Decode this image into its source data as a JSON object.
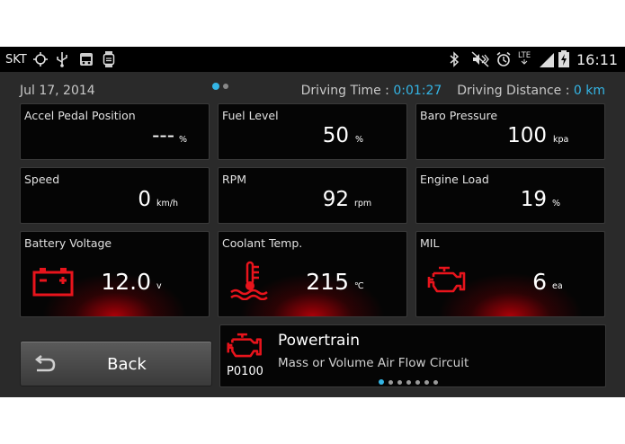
{
  "status_bar": {
    "carrier": "SKT",
    "network_type": "LTE",
    "time": "16:11",
    "left_icons": [
      "gps-icon",
      "usb-icon",
      "car-icon",
      "watch-icon"
    ],
    "right_icons": [
      "bluetooth-icon",
      "mute-icon",
      "alarm-icon",
      "signal-icon",
      "battery-charging-icon"
    ]
  },
  "header": {
    "date": "Jul 17, 2014",
    "driving_time_label": "Driving Time : ",
    "driving_time_value": "0:01:27",
    "driving_distance_label": "Driving Distance : ",
    "driving_distance_value": "0 km",
    "page_indicator": {
      "pages": 2,
      "current": 1
    }
  },
  "gauges": {
    "accel": {
      "title": "Accel Pedal Position",
      "value": "---",
      "unit": "%"
    },
    "fuel": {
      "title": "Fuel Level",
      "value": "50",
      "unit": "%"
    },
    "baro": {
      "title": "Baro Pressure",
      "value": "100",
      "unit": "kpa"
    },
    "speed": {
      "title": "Speed",
      "value": "0",
      "unit": "km/h"
    },
    "rpm": {
      "title": "RPM",
      "value": "92",
      "unit": "rpm"
    },
    "load": {
      "title": "Engine Load",
      "value": "19",
      "unit": "%"
    },
    "battery": {
      "title": "Battery Voltage",
      "value": "12.0",
      "unit": "v",
      "icon": "battery-icon"
    },
    "coolant": {
      "title": "Coolant Temp.",
      "value": "215",
      "unit": "℃",
      "icon": "coolant-temp-icon"
    },
    "mil": {
      "title": "MIL",
      "value": "6",
      "unit": "ea",
      "icon": "check-engine-icon"
    }
  },
  "back_button": {
    "label": "Back",
    "icon": "back-arrow-icon"
  },
  "dtc": {
    "category": "Powertrain",
    "code": "P0100",
    "description": "Mass or Volume Air Flow Circuit",
    "icon": "check-engine-icon",
    "pager": {
      "count": 7,
      "current": 1
    }
  },
  "colors": {
    "accent": "#34b5e5",
    "alert_red": "#e8141c",
    "background": "#2a2a2a",
    "card": "#050505"
  }
}
